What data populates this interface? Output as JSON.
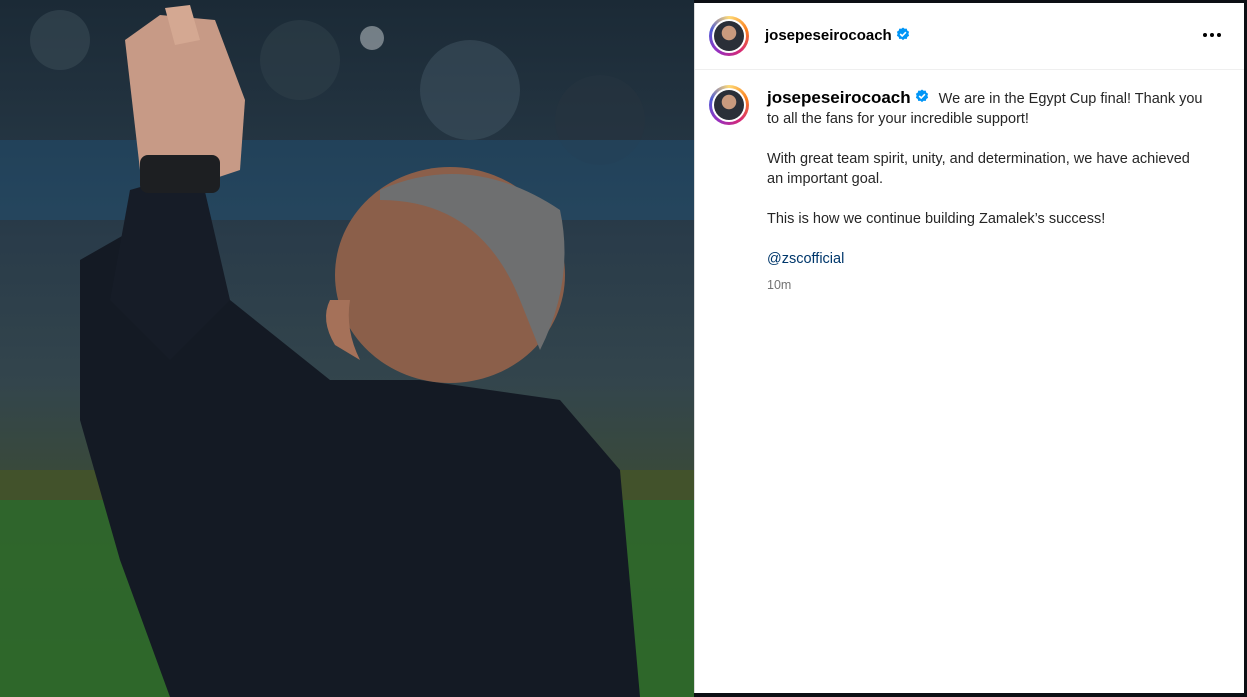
{
  "post": {
    "username": "josepeseirocoach",
    "caption_lines": [
      "We are in the Egypt Cup final! Thank you to all the fans for your incredible support!",
      "With great team spirit, unity, and determination, we have achieved an important goal.",
      "This is how we continue building Zamalek’s success!"
    ],
    "mention": "@zscofficial",
    "time_ago": "10m"
  },
  "icons": {
    "avatar": "profile-photo",
    "verified": "verified-badge-icon",
    "more": "more-options-icon"
  },
  "colors": {
    "verified": "#0095f6",
    "mention": "#00376b",
    "timestamp": "#737373"
  }
}
